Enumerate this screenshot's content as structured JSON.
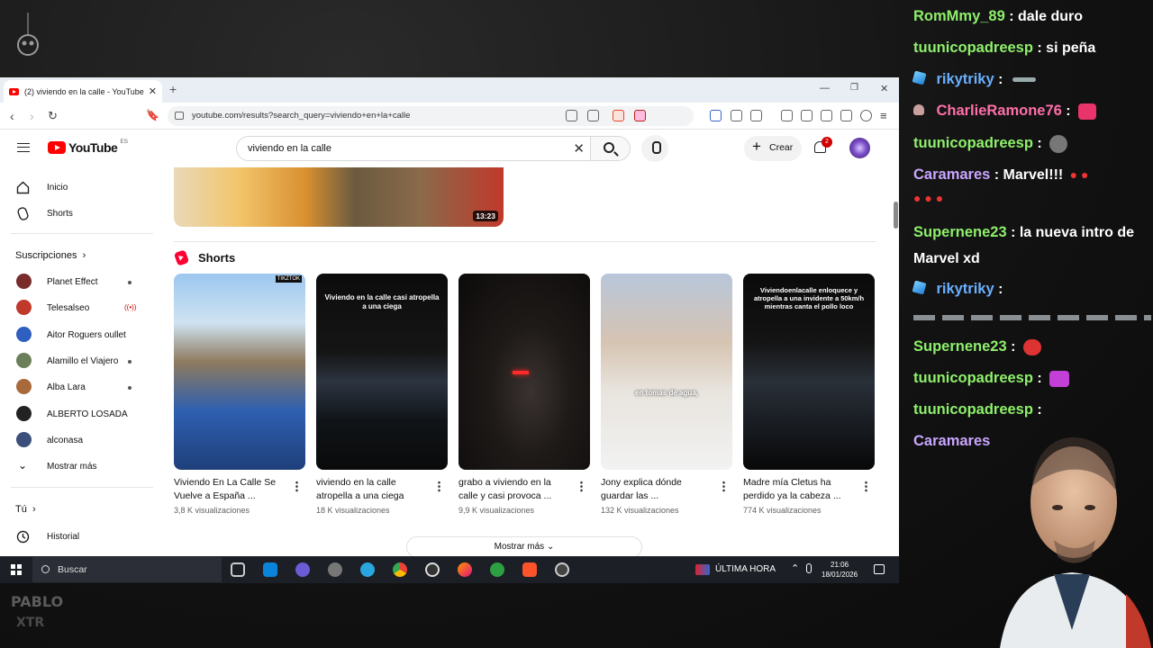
{
  "colors": {
    "yt_red": "#ff0000",
    "chat_green": "#8ef06b",
    "chat_blue": "#6ab0ff",
    "chat_pink": "#ff6fa8",
    "chat_purple": "#c9a6ff",
    "dark_bg": "#141414"
  },
  "browser": {
    "tab_title": "(2) viviendo en la calle - YouTube",
    "url": "youtube.com/results?search_query=viviendo+en+la+calle"
  },
  "youtube": {
    "logo_text": "YouTube",
    "region": "ES",
    "search_value": "viviendo en la calle",
    "create_label": "Crear",
    "notif_count": "2",
    "sidebar": {
      "home": "Inicio",
      "shorts": "Shorts",
      "subs_title": "Suscripciones",
      "subs_chevron": "›",
      "channels": [
        {
          "name": "Planet Effect",
          "color": "#7a2b2b"
        },
        {
          "name": "Telesalseo",
          "color": "#c0392b"
        },
        {
          "name": "Aitor Roguers oullet",
          "color": "#2f5fbf"
        },
        {
          "name": "Alamillo el Viajero",
          "color": "#6b7f5a"
        },
        {
          "name": "Alba Lara",
          "color": "#a86a3b"
        },
        {
          "name": "ALBERTO LOSADA",
          "color": "#222222"
        },
        {
          "name": "alconasa",
          "color": "#3b4f7a"
        }
      ],
      "show_more": "Mostrar más",
      "you": "Tú",
      "you_chevron": "›",
      "history": "Historial"
    },
    "top_video_duration": "13:23",
    "shorts_title": "Shorts",
    "shorts": [
      {
        "title": "Viviendo En La Calle Se Vuelve a España ...",
        "views": "3,8 K visualizaciones",
        "caption": "",
        "badge": "TIKZTOK"
      },
      {
        "title": "viviendo en la calle atropella a una ciega",
        "views": "18 K visualizaciones",
        "caption": "Viviendo en la calle casi atropella a una ciega",
        "badge": ""
      },
      {
        "title": "grabo a viviendo en la calle y casi provoca ...",
        "views": "9,9 K visualizaciones",
        "caption": "",
        "badge": ""
      },
      {
        "title": "Jony explica dónde guardar las ...",
        "views": "132 K visualizaciones",
        "caption": "en tomas de agua,",
        "badge": ""
      },
      {
        "title": "Madre mía Cletus ha perdido ya la cabeza ...",
        "views": "774 K visualizaciones",
        "caption": "Viviendoenlacalle enloquece y atropella a una invidente a 50km/h mientras canta el pollo loco",
        "badge": ""
      }
    ],
    "show_more_btn": "Mostrar más"
  },
  "taskbar": {
    "search_label": "Buscar",
    "news": "ÚLTIMA HORA",
    "time": "21:06",
    "date": "18/01/2026"
  },
  "chat": [
    {
      "user": "RomMmy_89",
      "text": ": dale duro",
      "color": "#8ef06b"
    },
    {
      "user": "tuunicopadreesp",
      "text": ": si peña",
      "color": "#8ef06b"
    },
    {
      "user": "rikytriky",
      "text": ":",
      "color": "#6ab0ff"
    },
    {
      "user": "CharlieRamone76",
      "text": ":",
      "color": "#ff6fa8"
    },
    {
      "user": "tuunicopadreesp",
      "text": ":",
      "color": "#8ef06b"
    },
    {
      "user": "Caramares",
      "text": ": Marvel!!!",
      "color": "#c9a6ff"
    },
    {
      "user": "Supernene23",
      "text": ": la nueva intro de Marvel xd",
      "color": "#8ef06b"
    },
    {
      "user": "rikytriky",
      "text": ":",
      "color": "#6ab0ff"
    },
    {
      "user": "Supernene23",
      "text": ":",
      "color": "#8ef06b"
    },
    {
      "user": "tuunicopadreesp",
      "text": ":",
      "color": "#8ef06b"
    },
    {
      "user": "tuunicopadreesp",
      "text": ":",
      "color": "#8ef06b"
    },
    {
      "user": "Caramares",
      "text": "",
      "color": "#c9a6ff"
    }
  ]
}
